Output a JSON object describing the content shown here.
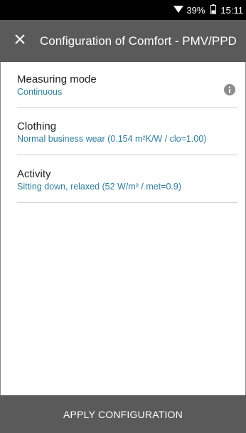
{
  "status_bar": {
    "wifi_icon": "wifi-icon",
    "battery_percent": "39%",
    "battery_icon": "battery-icon",
    "time": "15:11"
  },
  "app_bar": {
    "close_icon": "close-icon",
    "title": "Configuration of Comfort - PMV/PPD",
    "background": "#5a5a5a"
  },
  "settings": {
    "items": [
      {
        "label": "Measuring mode",
        "value": "Continuous",
        "icon": "info-icon"
      },
      {
        "label": "Clothing",
        "value": "Normal business wear (0.154 m²K/W / clo=1.00)"
      },
      {
        "label": "Activity",
        "value": "Sitting down, relaxed (52 W/m² / met=0.9)"
      }
    ]
  },
  "footer": {
    "apply_label": "APPLY CONFIGURATION"
  },
  "colors": {
    "accent": "#2e7d9b",
    "bar": "#5a5a5a"
  }
}
